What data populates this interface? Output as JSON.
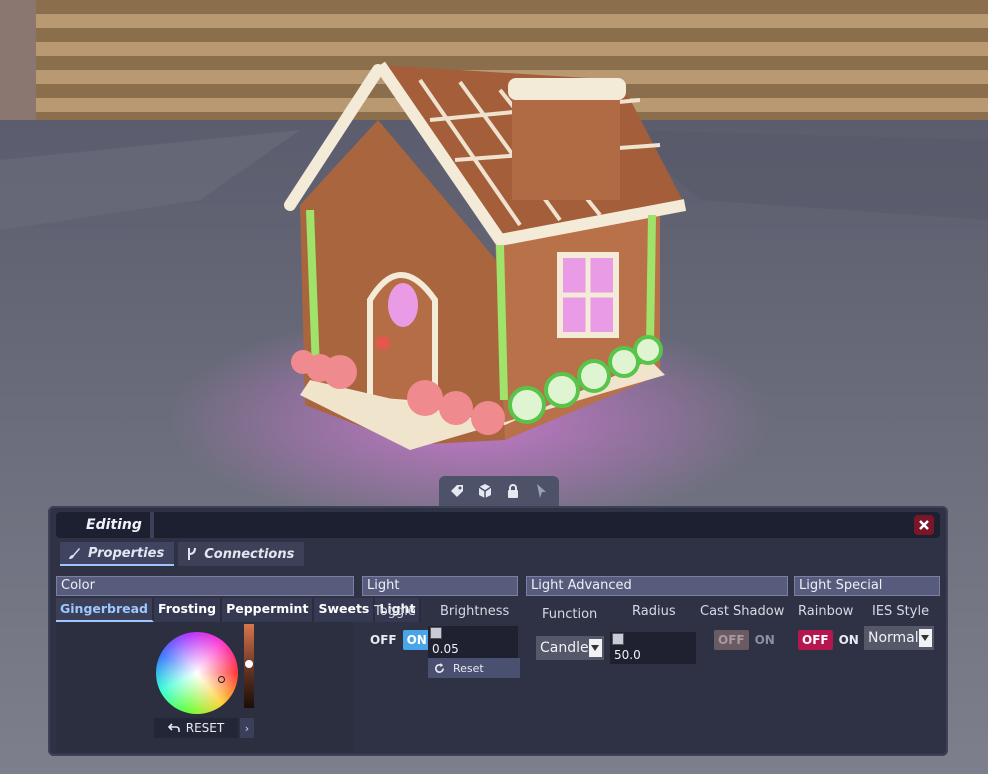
{
  "toolbar": {
    "icons": [
      "tag-icon",
      "cube-icon",
      "lock-icon",
      "cursor-icon"
    ]
  },
  "panel": {
    "title": "Editing",
    "tabs": [
      {
        "label": "Properties",
        "icon": "brush-icon",
        "active": true
      },
      {
        "label": "Connections",
        "icon": "branch-icon",
        "active": false
      }
    ]
  },
  "color": {
    "header": "Color",
    "subtabs": [
      "Gingerbread",
      "Frosting",
      "Peppermint",
      "Sweets",
      "Light"
    ],
    "active_subtab": "Gingerbread",
    "reset_label": "RESET",
    "value_level": 0.48
  },
  "light": {
    "header": "Light",
    "toggle_label": "Toggle",
    "off": "OFF",
    "on": "ON",
    "brightness_label": "Brightness",
    "brightness_value": "0.05",
    "reset_label": "Reset"
  },
  "advanced": {
    "header": "Light Advanced",
    "function_label": "Function",
    "function_value": "Candle",
    "radius_label": "Radius",
    "radius_value": "50.0",
    "shadow_label": "Cast Shadow",
    "off": "OFF",
    "on": "ON"
  },
  "special": {
    "header": "Light Special",
    "rainbow_label": "Rainbow",
    "off": "OFF",
    "on": "ON",
    "ies_label": "IES Style",
    "ies_value": "Normal"
  },
  "colors": {
    "accent_blue": "#4aa4e8",
    "rainbow_off": "#b4164e",
    "close": "#7a1628"
  }
}
